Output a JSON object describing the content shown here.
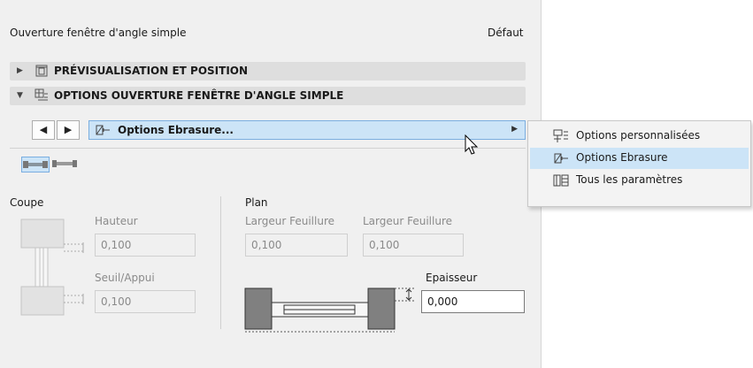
{
  "panel": {
    "title": "Ouverture fenêtre d'angle simple",
    "default_label": "Défaut"
  },
  "sections": {
    "preview": {
      "label": "PRÉVISUALISATION ET POSITION",
      "collapsed": true
    },
    "options": {
      "label": "OPTIONS OUVERTURE FENÊTRE D'ANGLE SIMPLE",
      "collapsed": false
    }
  },
  "nav": {
    "prev_symbol": "◀",
    "next_symbol": "▶",
    "combo_label": "Options Ebrasure...",
    "combo_icon": "reveal-options-icon"
  },
  "mini_toolbar": [
    "reveal-type-1-icon",
    "reveal-type-2-icon"
  ],
  "coupe": {
    "heading": "Coupe",
    "hauteur_label": "Hauteur",
    "hauteur_value": "0,100",
    "seuil_label": "Seuil/Appui",
    "seuil_value": "0,100"
  },
  "plan": {
    "heading": "Plan",
    "largeur1_label": "Largeur Feuillure",
    "largeur1_value": "0,100",
    "largeur2_label": "Largeur Feuillure",
    "largeur2_value": "0,100",
    "epaisseur_label": "Epaisseur",
    "epaisseur_value": "0,000"
  },
  "menu": {
    "items": [
      {
        "label": "Options personnalisées",
        "icon": "custom-options-icon",
        "selected": false
      },
      {
        "label": "Options Ebrasure",
        "icon": "reveal-options-icon",
        "selected": true
      },
      {
        "label": "Tous les paramètres",
        "icon": "all-parameters-icon",
        "selected": false
      }
    ]
  },
  "colors": {
    "panel_bg": "#f0f0f0",
    "section_bg": "#dedede",
    "highlight": "#cce4f7",
    "highlight_border": "#7aaee0"
  }
}
